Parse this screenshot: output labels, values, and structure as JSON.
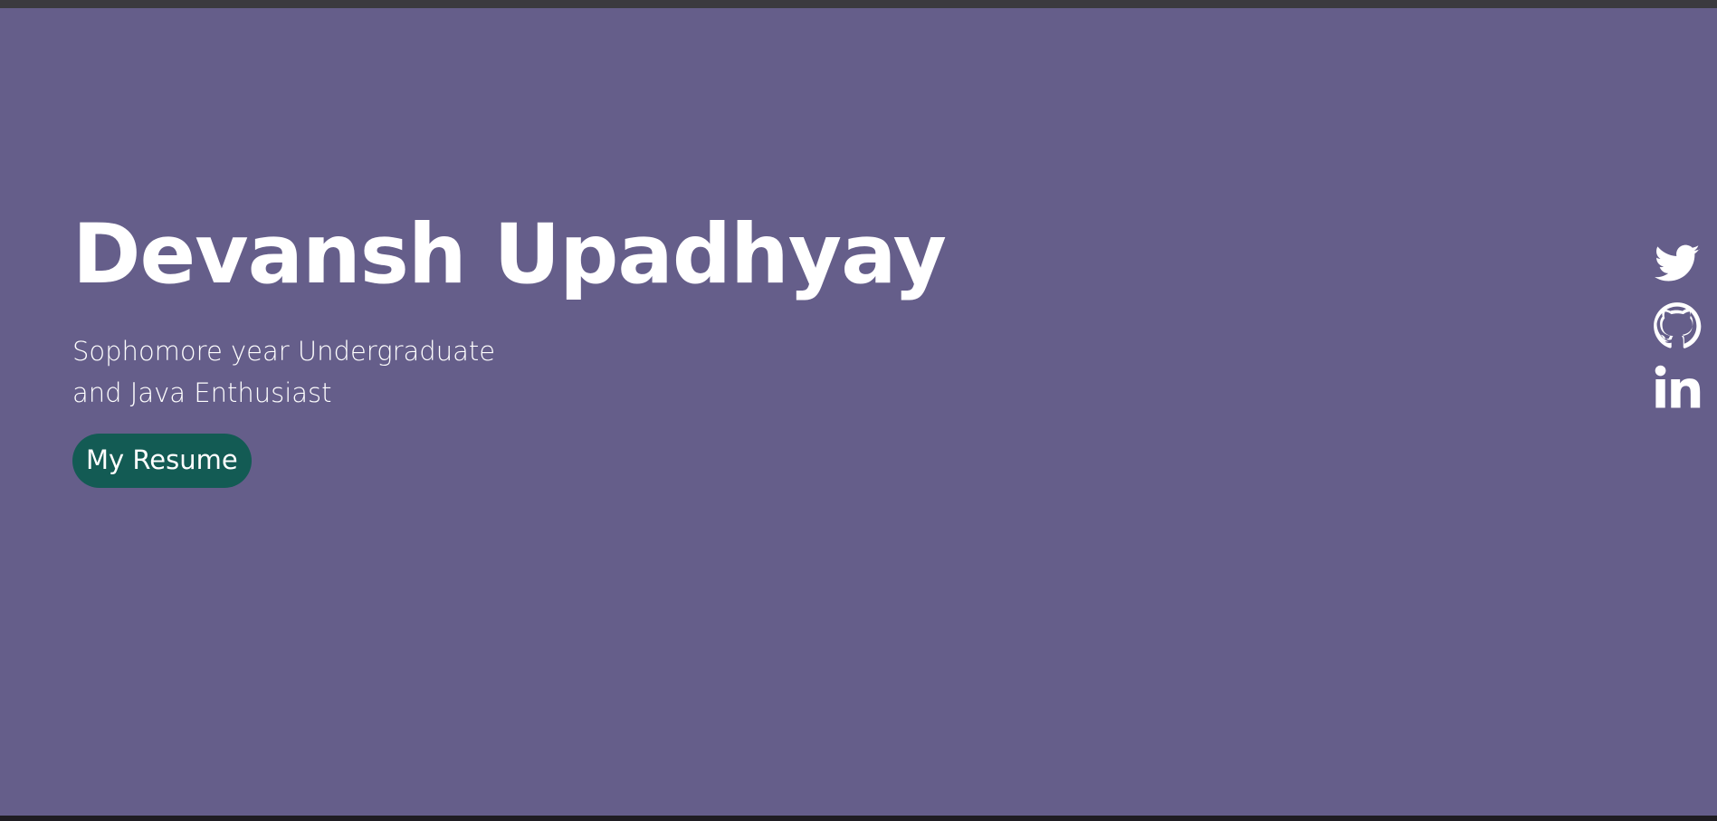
{
  "hero": {
    "name": "Devansh Upadhyay",
    "subtitle": "Sophomore year Undergraduate and Java Enthusiast",
    "resume_button_label": "My Resume"
  },
  "social_links": [
    {
      "icon": "twitter-icon"
    },
    {
      "icon": "github-icon"
    },
    {
      "icon": "linkedin-icon"
    }
  ],
  "colors": {
    "hero_background": "#655e8a",
    "button_background": "#135b54",
    "text": "#ffffff"
  }
}
